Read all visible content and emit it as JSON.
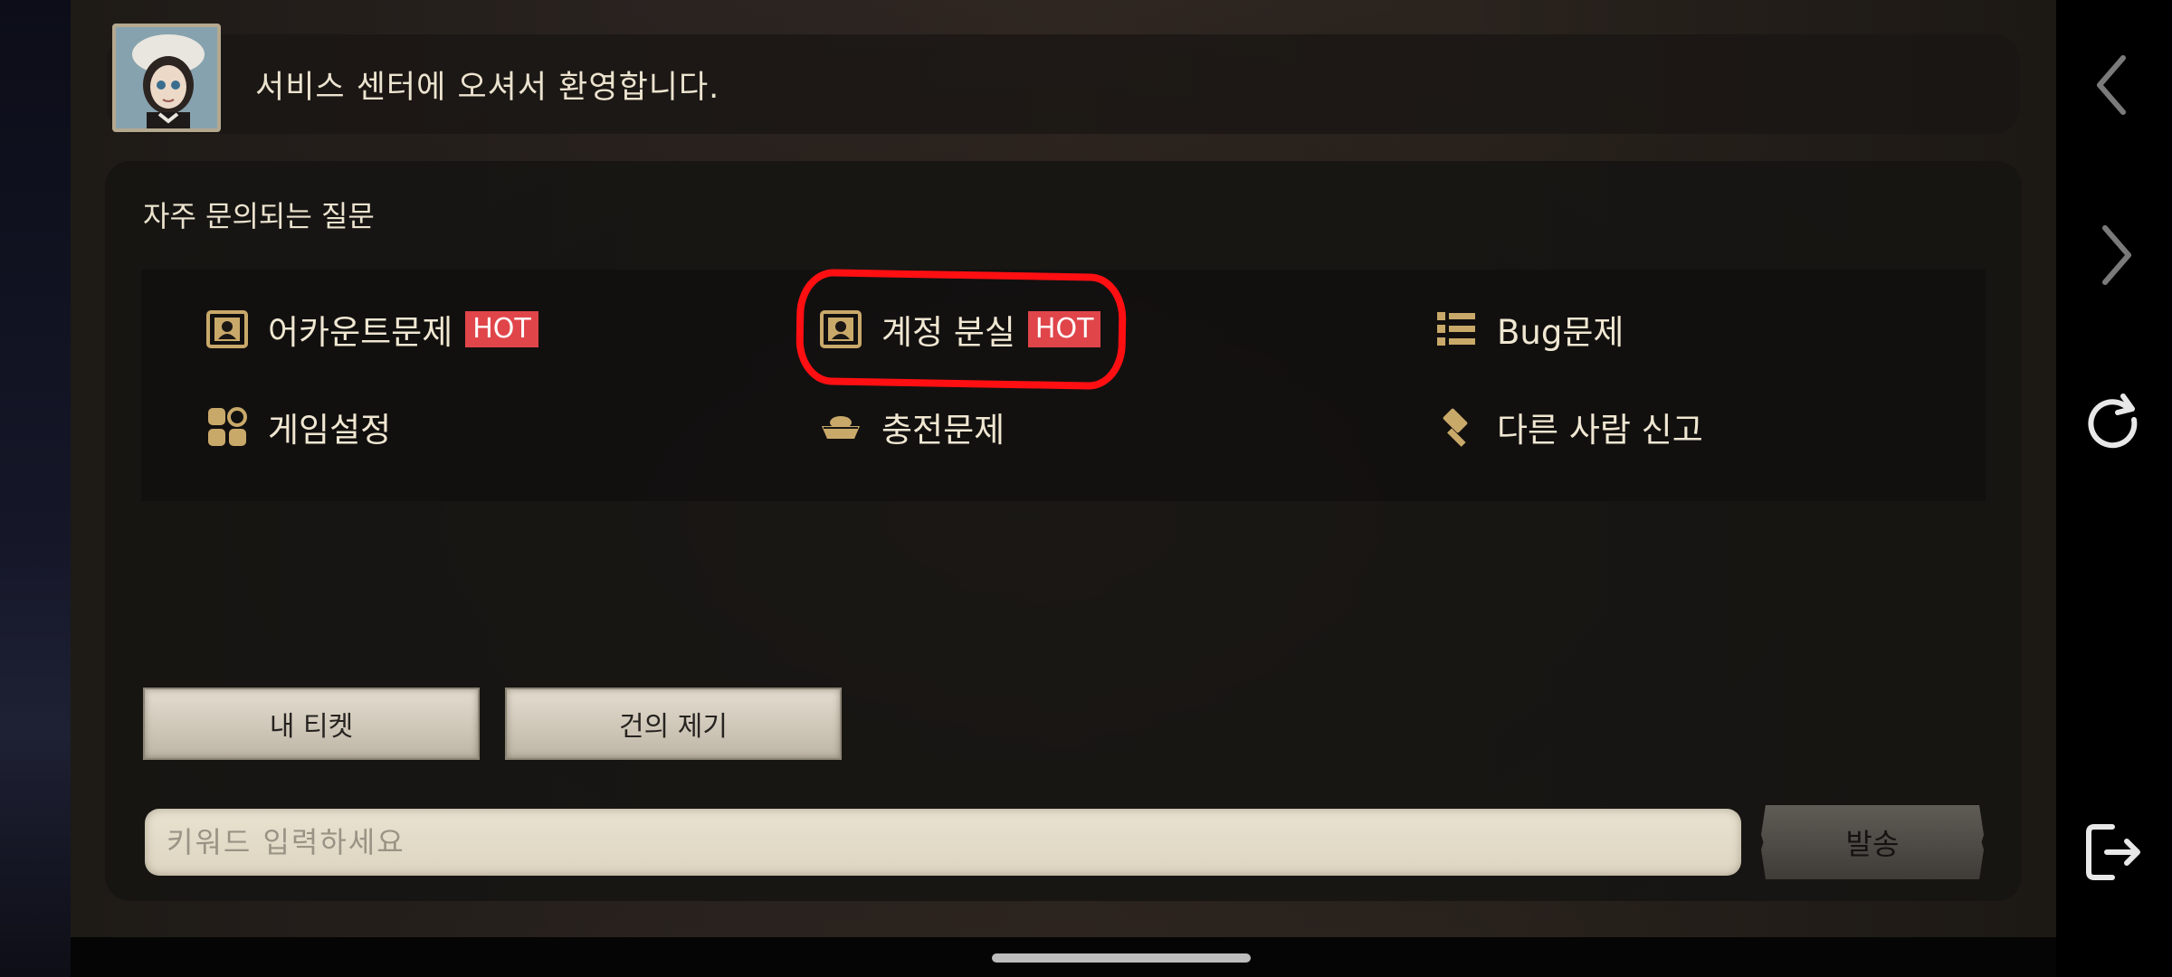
{
  "header": {
    "welcome_text": "서비스 센터에 오셔서 환영합니다."
  },
  "faq": {
    "title": "자주 문의되는 질문",
    "items": [
      {
        "label": "어카운트문제",
        "badge": "HOT",
        "icon": "account-card-icon"
      },
      {
        "label": "계정 분실",
        "badge": "HOT",
        "icon": "account-card-icon"
      },
      {
        "label": "Bug문제",
        "badge": "",
        "icon": "list-icon"
      },
      {
        "label": "게임설정",
        "badge": "",
        "icon": "settings-grid-icon"
      },
      {
        "label": "충전문제",
        "badge": "",
        "icon": "ingot-icon"
      },
      {
        "label": "다른 사람 신고",
        "badge": "",
        "icon": "gavel-icon"
      }
    ]
  },
  "buttons": {
    "my_tickets": "내 티켓",
    "suggestion": "건의 제기",
    "send": "발송"
  },
  "search": {
    "placeholder": "키워드 입력하세요",
    "value": ""
  },
  "rail": [
    "back-icon",
    "forward-icon",
    "refresh-icon",
    "exit-icon"
  ],
  "colors": {
    "accent_text": "#ece3cf",
    "icon_gold": "#c9a96a",
    "hot_badge": "#e0454a",
    "highlight": "#ff0f12"
  }
}
